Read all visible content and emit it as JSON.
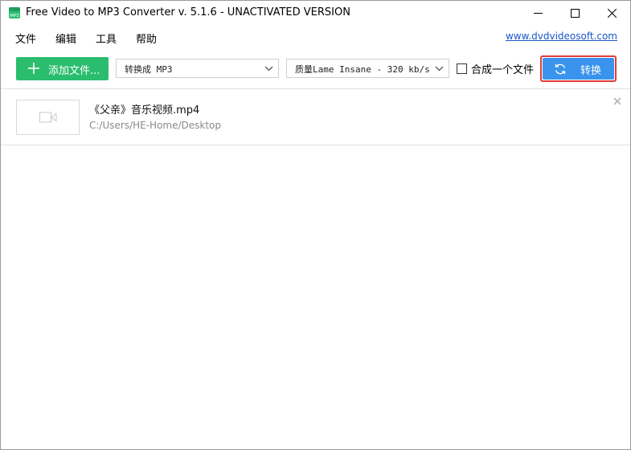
{
  "window": {
    "title": "Free Video to MP3 Converter v. 5.1.6 - UNACTIVATED VERSION",
    "app_icon_text": "MP3"
  },
  "menu": {
    "items": [
      {
        "label": "文件"
      },
      {
        "label": "编辑"
      },
      {
        "label": "工具"
      },
      {
        "label": "帮助"
      }
    ],
    "website_link": "www.dvdvideosoft.com"
  },
  "toolbar": {
    "add_files_label": "添加文件...",
    "format_select_value": "转换成 MP3",
    "quality_select_value": "质量Lame Insane - 320 kb/s",
    "merge_label": "合成一个文件",
    "merge_checked": false,
    "convert_label": "转换"
  },
  "files": [
    {
      "name": "《父亲》音乐视频.mp4",
      "path": "C:/Users/HE-Home/Desktop"
    }
  ],
  "colors": {
    "add_button": "#2bbd6e",
    "convert_button": "#3a93ec",
    "highlight_border": "#e23b3b",
    "link": "#1a56c8"
  }
}
